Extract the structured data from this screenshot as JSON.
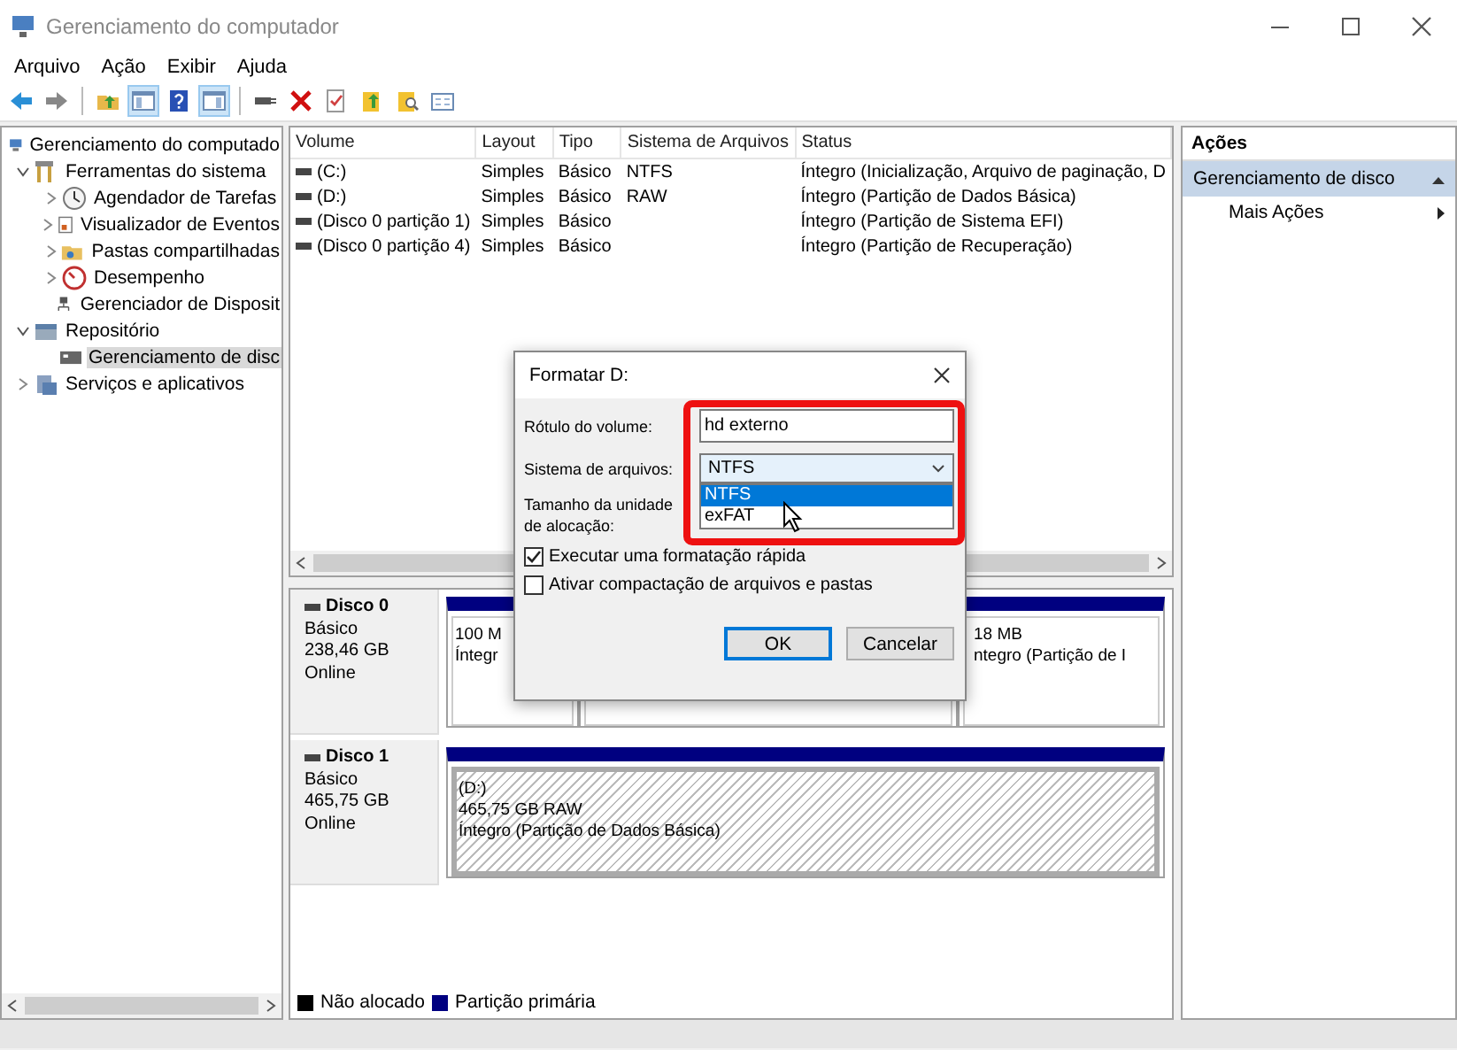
{
  "window": {
    "title": "Gerenciamento do computador"
  },
  "menu": [
    "Arquivo",
    "Ação",
    "Exibir",
    "Ajuda"
  ],
  "toolbar": [
    {
      "kind": "button",
      "pressed": false
    },
    {
      "kind": "button",
      "pressed": false
    },
    {
      "kind": "separator"
    },
    {
      "kind": "button",
      "pressed": false
    },
    {
      "kind": "button",
      "pressed": true
    },
    {
      "kind": "button",
      "pressed": false
    },
    {
      "kind": "button",
      "pressed": true
    },
    {
      "kind": "separator"
    },
    {
      "kind": "button",
      "pressed": false
    },
    {
      "kind": "button",
      "pressed": false
    },
    {
      "kind": "button",
      "pressed": false
    },
    {
      "kind": "button",
      "pressed": false
    },
    {
      "kind": "button",
      "pressed": false
    },
    {
      "kind": "button",
      "pressed": false
    }
  ],
  "tree": [
    {
      "label": "Gerenciamento do computado",
      "expandable": false,
      "selected": false,
      "children": [
        {
          "label": "Ferramentas do sistema",
          "expandable": true,
          "expanded": true,
          "selected": false,
          "children": [
            {
              "label": "Agendador de Tarefas",
              "expandable": true,
              "expanded": false,
              "selected": false
            },
            {
              "label": "Visualizador de Eventos",
              "expandable": true,
              "expanded": false,
              "selected": false
            },
            {
              "label": "Pastas compartilhadas",
              "expandable": true,
              "expanded": false,
              "selected": false
            },
            {
              "label": "Desempenho",
              "expandable": true,
              "expanded": false,
              "selected": false
            },
            {
              "label": "Gerenciador de Disposit",
              "expandable": false,
              "selected": false
            }
          ]
        },
        {
          "label": "Repositório",
          "expandable": true,
          "expanded": true,
          "selected": false,
          "children": [
            {
              "label": "Gerenciamento de disc",
              "expandable": false,
              "selected": true
            }
          ]
        },
        {
          "label": "Serviços e aplicativos",
          "expandable": true,
          "expanded": false,
          "selected": false
        }
      ]
    }
  ],
  "table": {
    "columns": [
      "Volume",
      "Layout",
      "Tipo",
      "Sistema de Arquivos",
      "Status"
    ],
    "rows": [
      {
        "selected": false,
        "cells": [
          "(C:)",
          "Simples",
          "Básico",
          "NTFS",
          "Íntegro (Inicialização, Arquivo de paginação, D"
        ]
      },
      {
        "selected": false,
        "cells": [
          "(D:)",
          "Simples",
          "Básico",
          "RAW",
          "Íntegro (Partição de Dados Básica)"
        ]
      },
      {
        "selected": false,
        "cells": [
          "(Disco 0 partição 1)",
          "Simples",
          "Básico",
          null,
          "Íntegro (Partição de Sistema EFI)"
        ]
      },
      {
        "selected": false,
        "cells": [
          "(Disco 0 partição 4)",
          "Simples",
          "Básico",
          null,
          "Íntegro (Partição de Recuperação)"
        ]
      }
    ]
  },
  "disks": [
    {
      "name": "Disco 0",
      "lines": [
        "Básico",
        "238,46 GB",
        "Online"
      ],
      "partitions": [
        {
          "selected": false,
          "lines": [
            "100 M",
            "Íntegr"
          ]
        },
        {
          "selected": false
        },
        {
          "selected": false,
          "lines": [
            "18 MB",
            "ntegro (Partição de I"
          ]
        }
      ]
    },
    {
      "name": "Disco 1",
      "lines": [
        "Básico",
        "465,75 GB",
        "Online"
      ],
      "partitions": [
        {
          "selected": true,
          "lines": [
            "(D:)",
            "465,75 GB RAW",
            "Íntegro (Partição de Dados Básica)"
          ]
        }
      ]
    }
  ],
  "legend": [
    {
      "label": "Não alocado",
      "color": "#000000"
    },
    {
      "label": "Partição primária",
      "color": "#000080"
    }
  ],
  "actions": {
    "title": "Ações",
    "sections": [
      {
        "label": "Gerenciamento de disco",
        "expanded": true,
        "items": [
          "Mais Ações"
        ]
      }
    ]
  },
  "dialog": {
    "title": "Formatar D:",
    "volume_label": {
      "label": "Rótulo do volume:",
      "value": "hd externo"
    },
    "file_system": {
      "label": "Sistema de arquivos:",
      "value": "NTFS",
      "open": true,
      "options": [
        {
          "label": "NTFS",
          "selected": true
        },
        {
          "label": "exFAT",
          "selected": false
        }
      ]
    },
    "allocation": {
      "label": "Tamanho da unidade de alocação:"
    },
    "checkboxes": [
      {
        "label": "Executar uma formatação rápida",
        "checked": true
      },
      {
        "label": "Ativar compactação de arquivos e pastas",
        "checked": false
      }
    ],
    "buttons": [
      {
        "label": "OK",
        "default": true
      },
      {
        "label": "Cancelar",
        "default": false
      }
    ]
  }
}
